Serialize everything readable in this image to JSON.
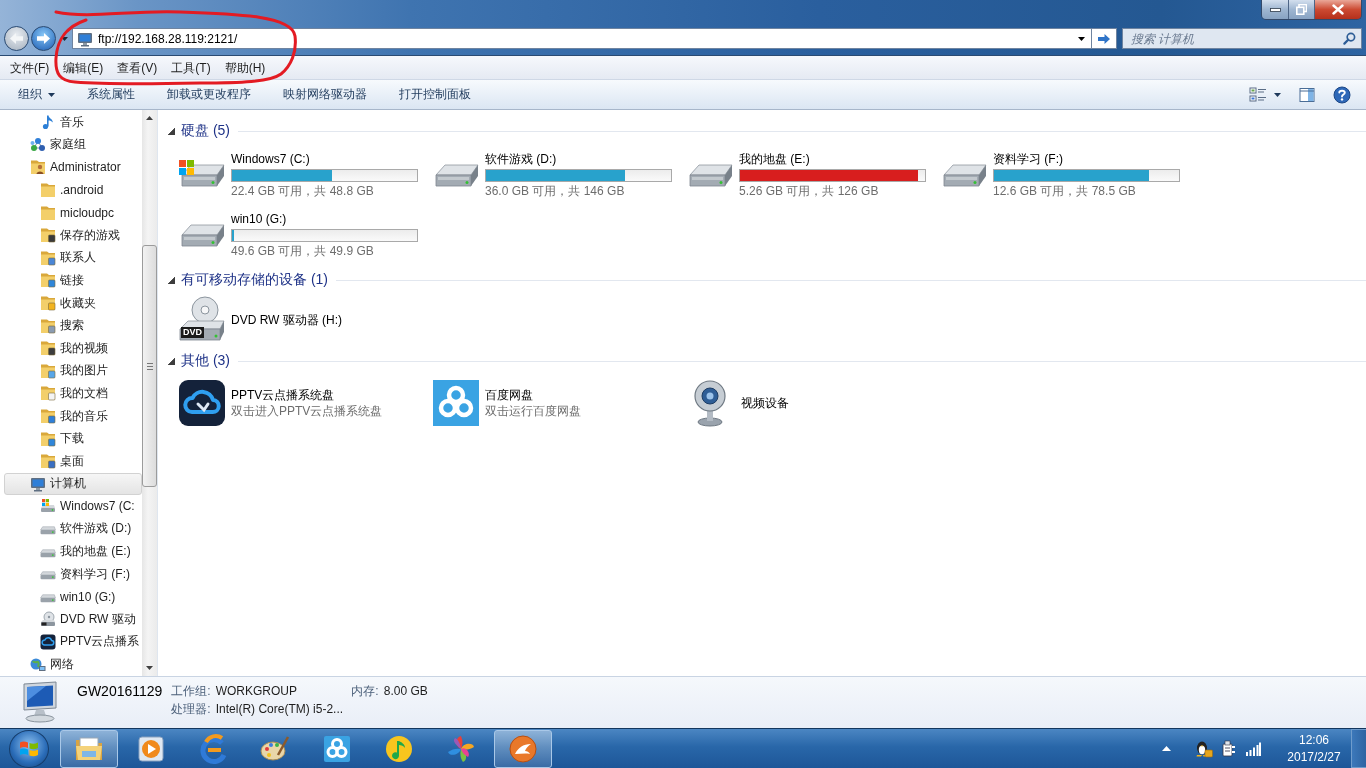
{
  "annotation": {
    "kind": "circle"
  },
  "navigation": [
    {
      "kind": "back",
      "disabled": true
    },
    {
      "kind": "forward",
      "disabled": false
    }
  ],
  "address_bar": {
    "value": "ftp://192.168.28.119:2121/"
  },
  "search": {
    "placeholder": "搜索 计算机"
  },
  "menu_bar": [
    "文件(F)",
    "编辑(E)",
    "查看(V)",
    "工具(T)",
    "帮助(H)"
  ],
  "toolbar": {
    "buttons": [
      {
        "label": "组织",
        "kind": "menu"
      },
      {
        "label": "系统属性",
        "kind": "command"
      },
      {
        "label": "卸载或更改程序",
        "kind": "command"
      },
      {
        "label": "映射网络驱动器",
        "kind": "command"
      },
      {
        "label": "打开控制面板",
        "kind": "command"
      }
    ]
  },
  "nav_pane": {
    "items": [
      {
        "children": [
          {
            "label": "音乐",
            "kind": "music",
            "selected": false
          }
        ]
      },
      {
        "label": "家庭组",
        "kind": "homegroup",
        "selected": false
      },
      {
        "label": "Administrator",
        "kind": "user",
        "selected": false,
        "children": [
          {
            "label": ".android",
            "kind": "folder",
            "selected": false
          },
          {
            "label": "micloudpc",
            "kind": "folder",
            "selected": false
          },
          {
            "label": "保存的游戏",
            "kind": "games",
            "selected": false
          },
          {
            "label": "联系人",
            "kind": "contacts",
            "selected": false
          },
          {
            "label": "链接",
            "kind": "links",
            "selected": false
          },
          {
            "label": "收藏夹",
            "kind": "favorites",
            "selected": false
          },
          {
            "label": "搜索",
            "kind": "searches",
            "selected": false
          },
          {
            "label": "我的视频",
            "kind": "videos",
            "selected": false
          },
          {
            "label": "我的图片",
            "kind": "pictures",
            "selected": false
          },
          {
            "label": "我的文档",
            "kind": "documents",
            "selected": false
          },
          {
            "label": "我的音乐",
            "kind": "songs",
            "selected": false
          },
          {
            "label": "下载",
            "kind": "downloads",
            "selected": false
          },
          {
            "label": "桌面",
            "kind": "desktop",
            "selected": false
          }
        ]
      },
      {
        "label": "计算机",
        "kind": "computer",
        "selected": true,
        "children": [
          {
            "label": "Windows7 (C:",
            "kind": "system",
            "selected": false
          },
          {
            "label": "软件游戏 (D:)",
            "kind": "drive",
            "selected": false
          },
          {
            "label": "我的地盘 (E:)",
            "kind": "drive",
            "selected": false
          },
          {
            "label": "资料学习 (F:)",
            "kind": "drive",
            "selected": false
          },
          {
            "label": "win10 (G:)",
            "kind": "drive",
            "selected": false
          },
          {
            "label": "DVD RW 驱动",
            "kind": "optical",
            "selected": false
          },
          {
            "label": "PPTV云点播系",
            "kind": "app",
            "selected": false
          }
        ]
      },
      {
        "label": "网络",
        "kind": "network",
        "selected": false
      }
    ]
  },
  "content": {
    "groups": [
      {
        "title": "硬盘 (5)",
        "expanded": true,
        "items": [
          {
            "kind": "system",
            "name": "Windows7 (C:)",
            "level": 0.54,
            "color": "#28a2cc",
            "free": "22.4 GB 可用，共 48.8 GB"
          },
          {
            "kind": "drive",
            "name": "软件游戏 (D:)",
            "level": 0.75,
            "color": "#28a2cc",
            "free": "36.0 GB 可用，共 146 GB"
          },
          {
            "kind": "drive",
            "name": "我的地盘 (E:)",
            "level": 0.96,
            "color": "#d81e1e",
            "free": "5.26 GB 可用，共 126 GB"
          },
          {
            "kind": "drive",
            "name": "资料学习 (F:)",
            "level": 0.84,
            "color": "#28a2cc",
            "free": "12.6 GB 可用，共 78.5 GB"
          },
          {
            "kind": "drive",
            "name": "win10 (G:)",
            "level": 0.01,
            "color": "#28a2cc",
            "free": "49.6 GB 可用，共 49.9 GB"
          }
        ]
      },
      {
        "title": "有可移动存储的设备 (1)",
        "expanded": true,
        "items": [
          {
            "kind": "optical",
            "name": "DVD RW 驱动器 (H:)",
            "badge": "DVD"
          }
        ]
      },
      {
        "title": "其他 (3)",
        "expanded": true,
        "items": [
          {
            "kind": "app",
            "name": "PPTV云点播系统盘",
            "description": "双击进入PPTV云点播系统盘"
          },
          {
            "kind": "app",
            "name": "百度网盘",
            "description": "双击运行百度网盘"
          },
          {
            "kind": "camera",
            "name": "视频设备"
          }
        ]
      }
    ]
  },
  "details_pane": {
    "name": "GW20161129",
    "fields": [
      {
        "label": "工作组:",
        "value": "WORKGROUP"
      },
      {
        "label": "内存:",
        "value": "8.00 GB"
      },
      {
        "label": "处理器:",
        "value": "Intel(R) Core(TM) i5-2..."
      }
    ]
  },
  "taskbar": {
    "apps": [
      {
        "running": true
      },
      {
        "running": false
      },
      {
        "running": false
      },
      {
        "running": false
      },
      {
        "running": false
      },
      {
        "running": false
      },
      {
        "running": false
      },
      {
        "running": true
      }
    ],
    "clock": {
      "time": "12:06",
      "date": "2017/2/27"
    }
  }
}
